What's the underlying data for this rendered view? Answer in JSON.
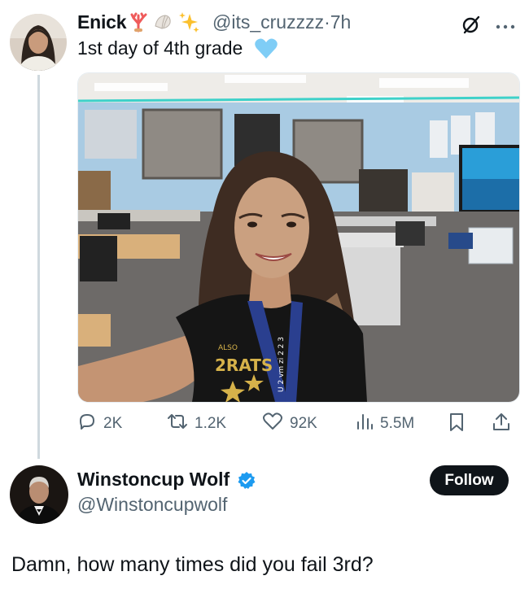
{
  "tweet": {
    "author_name": "Enick",
    "name_emojis": [
      "coral-emoji",
      "shell-emoji",
      "sparkles-emoji"
    ],
    "handle": "@its_cruzzzz",
    "separator": "·",
    "time": "7h",
    "text": "1st day of 4th grade",
    "text_emoji": "light-blue-heart-emoji",
    "media": {
      "kind": "photo",
      "subject": "selfie in classroom",
      "shirt_text": "ALSO",
      "shirt_graphic_text": "2RATS",
      "lanyard_text": "U 2 vm zi 2 2 3"
    },
    "actions": {
      "replies": "2K",
      "reposts": "1.2K",
      "likes": "92K",
      "views": "5.5M"
    }
  },
  "reply": {
    "author_name": "Winstoncup Wolf",
    "handle": "@Winstoncupwolf",
    "verified": true,
    "follow_label": "Follow",
    "text": "Damn, how many times did you fail 3rd?"
  },
  "colors": {
    "text_primary": "#0f1419",
    "text_secondary": "#536471",
    "verified_blue": "#1d9bf0",
    "follow_bg": "#0f1419"
  }
}
